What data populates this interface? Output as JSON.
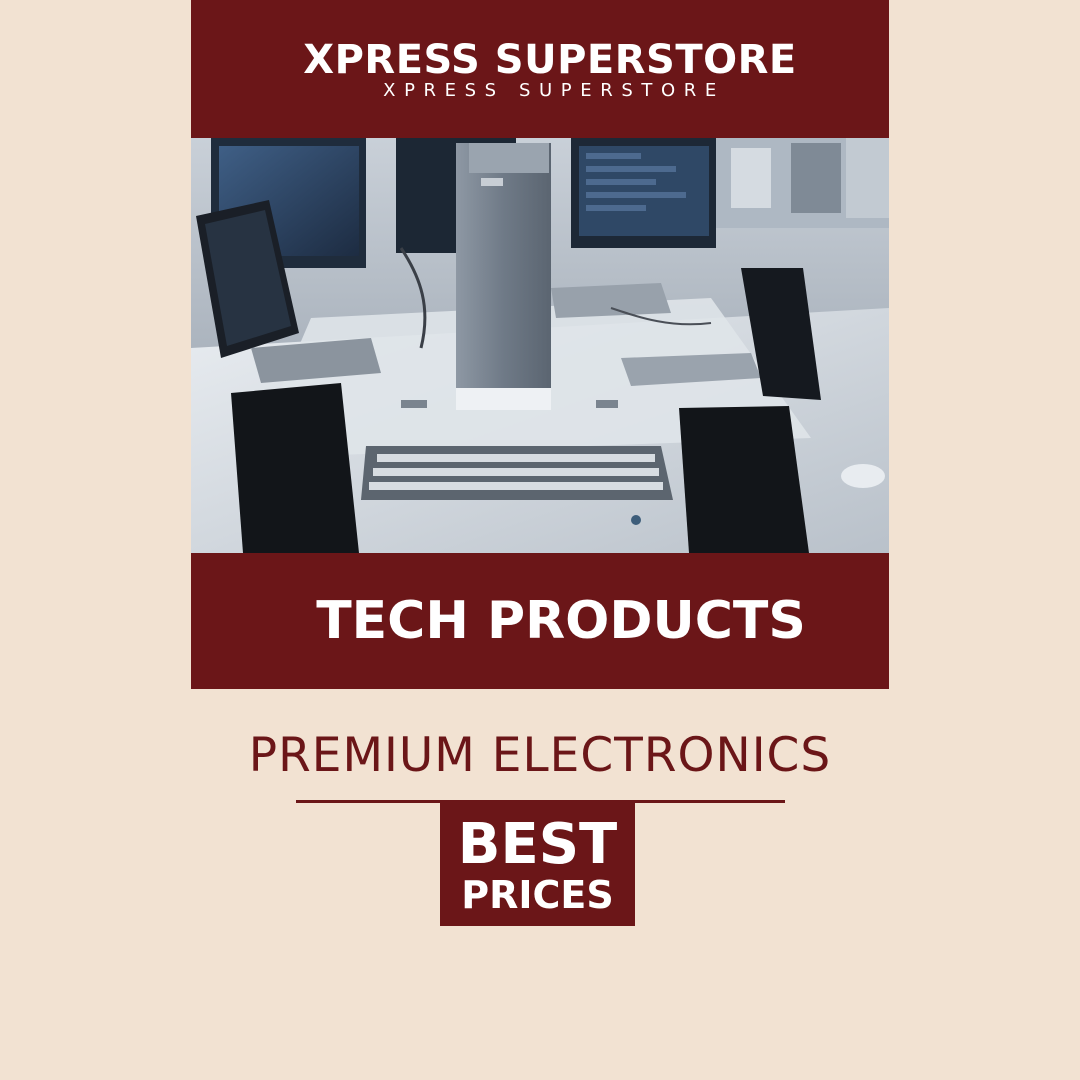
{
  "header": {
    "brand": "XPRESS SUPERSTORE",
    "brand_spaced": "XPRESS SUPERSTORE"
  },
  "hero": {
    "kind": "photo-computers-on-desks"
  },
  "category": {
    "title": "TECH PRODUCTS"
  },
  "tagline": "PREMIUM ELECTRONICS",
  "badge": {
    "line1": "BEST",
    "line2": "PRICES"
  },
  "colors": {
    "background": "#f2e2d2",
    "accent": "#6b1618",
    "text_on_accent": "#ffffff"
  }
}
